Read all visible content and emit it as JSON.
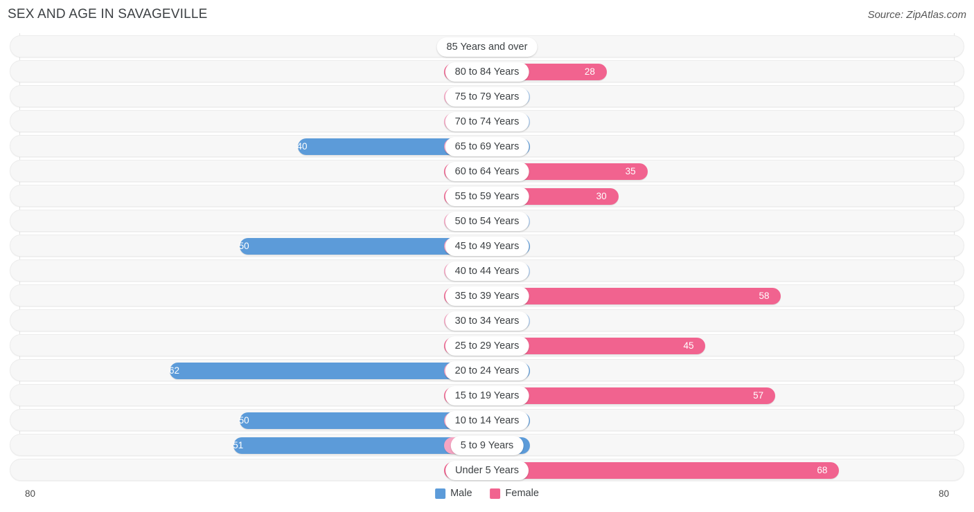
{
  "header": {
    "title": "SEX AND AGE IN SAVAGEVILLE",
    "source": "Source: ZipAtlas.com"
  },
  "footer": {
    "axis_left": "80",
    "axis_right": "80",
    "legend": [
      {
        "label": "Male",
        "color": "#5c9bd9"
      },
      {
        "label": "Female",
        "color": "#f1638f"
      }
    ]
  },
  "chart_data": {
    "type": "bar",
    "subtype": "population-pyramid",
    "title": "SEX AND AGE IN SAVAGEVILLE",
    "xlabel": "",
    "ylabel": "",
    "xlim": [
      80,
      80
    ],
    "axis_max": 80,
    "grid": false,
    "legend_position": "bottom-center",
    "categories": [
      "85 Years and over",
      "80 to 84 Years",
      "75 to 79 Years",
      "70 to 74 Years",
      "65 to 69 Years",
      "60 to 64 Years",
      "55 to 59 Years",
      "50 to 54 Years",
      "45 to 49 Years",
      "40 to 44 Years",
      "35 to 39 Years",
      "30 to 34 Years",
      "25 to 29 Years",
      "20 to 24 Years",
      "15 to 19 Years",
      "10 to 14 Years",
      "5 to 9 Years",
      "Under 5 Years"
    ],
    "series": [
      {
        "name": "Male",
        "color": "#5c9bd9",
        "values": [
          0,
          0,
          0,
          0,
          40,
          0,
          0,
          0,
          50,
          0,
          0,
          0,
          0,
          62,
          0,
          50,
          51,
          0
        ]
      },
      {
        "name": "Female",
        "color": "#f1638f",
        "values": [
          0,
          28,
          0,
          0,
          0,
          35,
          30,
          0,
          0,
          0,
          58,
          0,
          45,
          0,
          57,
          0,
          0,
          68
        ]
      }
    ],
    "rows": [
      {
        "label": "85 Years and over",
        "male": 0,
        "female": 0,
        "male_text": "0",
        "female_text": "0"
      },
      {
        "label": "80 to 84 Years",
        "male": 0,
        "female": 28,
        "male_text": "0",
        "female_text": "28"
      },
      {
        "label": "75 to 79 Years",
        "male": 0,
        "female": 0,
        "male_text": "0",
        "female_text": "0"
      },
      {
        "label": "70 to 74 Years",
        "male": 0,
        "female": 0,
        "male_text": "0",
        "female_text": "0"
      },
      {
        "label": "65 to 69 Years",
        "male": 40,
        "female": 0,
        "male_text": "40",
        "female_text": "0"
      },
      {
        "label": "60 to 64 Years",
        "male": 0,
        "female": 35,
        "male_text": "0",
        "female_text": "35"
      },
      {
        "label": "55 to 59 Years",
        "male": 0,
        "female": 30,
        "male_text": "0",
        "female_text": "30"
      },
      {
        "label": "50 to 54 Years",
        "male": 0,
        "female": 0,
        "male_text": "0",
        "female_text": "0"
      },
      {
        "label": "45 to 49 Years",
        "male": 50,
        "female": 0,
        "male_text": "50",
        "female_text": "0"
      },
      {
        "label": "40 to 44 Years",
        "male": 0,
        "female": 0,
        "male_text": "0",
        "female_text": "0"
      },
      {
        "label": "35 to 39 Years",
        "male": 0,
        "female": 58,
        "male_text": "0",
        "female_text": "58"
      },
      {
        "label": "30 to 34 Years",
        "male": 0,
        "female": 0,
        "male_text": "0",
        "female_text": "0"
      },
      {
        "label": "25 to 29 Years",
        "male": 0,
        "female": 45,
        "male_text": "0",
        "female_text": "45"
      },
      {
        "label": "20 to 24 Years",
        "male": 62,
        "female": 0,
        "male_text": "62",
        "female_text": "0"
      },
      {
        "label": "15 to 19 Years",
        "male": 0,
        "female": 57,
        "male_text": "0",
        "female_text": "57"
      },
      {
        "label": "10 to 14 Years",
        "male": 50,
        "female": 0,
        "male_text": "50",
        "female_text": "0"
      },
      {
        "label": "5 to 9 Years",
        "male": 51,
        "female": 0,
        "male_text": "51",
        "female_text": "0"
      },
      {
        "label": "Under 5 Years",
        "male": 0,
        "female": 68,
        "male_text": "0",
        "female_text": "68"
      }
    ]
  }
}
